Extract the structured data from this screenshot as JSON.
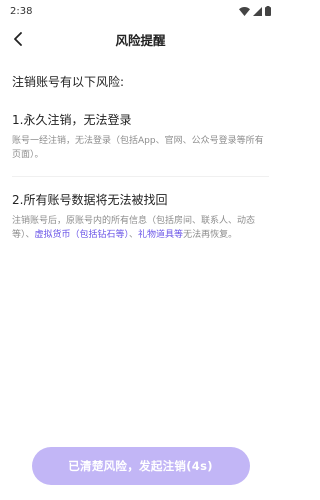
{
  "status_bar": {
    "time": "2:38"
  },
  "header": {
    "back_icon": "chevron-left-icon",
    "title": "风险提醒"
  },
  "intro": "注销账号有以下风险:",
  "risks": [
    {
      "title": "1.永久注销，无法登录",
      "desc": "账号一经注销，无法登录（包括App、官网、公众号登录等所有页面）。"
    },
    {
      "title": "2.所有账号数据将无法被找回",
      "desc_pre": "注销账号后，原账号内的所有信息（包括房间、联系人、动态等）、",
      "link1": "虚拟货币（包括钻石等）",
      "mid": "、",
      "link2": "礼物道具等",
      "desc_post": "无法再恢复。"
    }
  ],
  "button": {
    "label": "已清楚风险，发起注销(4s)"
  },
  "colors": {
    "accent": "#6a55e8",
    "button_bg": "#c2b6f6"
  }
}
